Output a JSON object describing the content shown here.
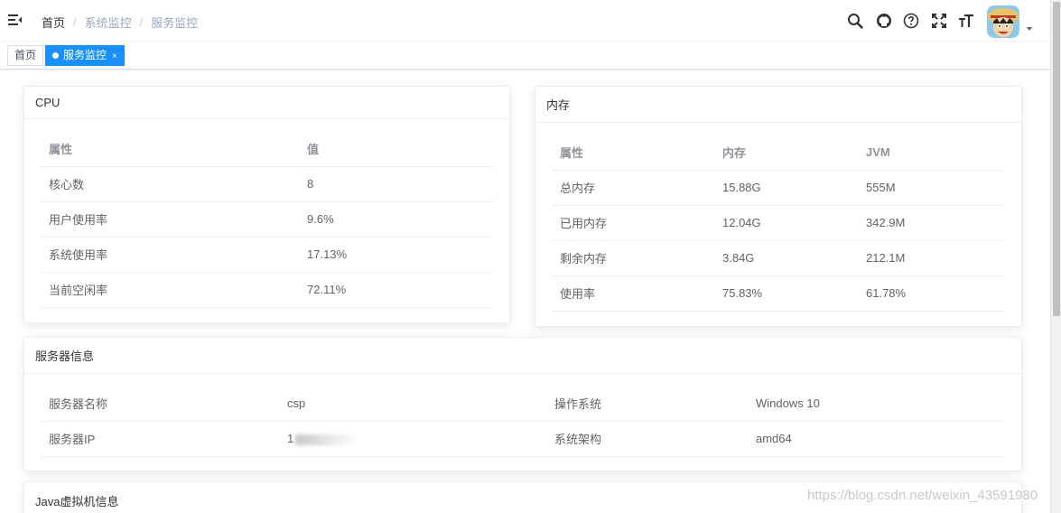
{
  "breadcrumb": {
    "home": "首页",
    "level1": "系统监控",
    "level2": "服务监控"
  },
  "tags": [
    {
      "label": "首页",
      "active": false
    },
    {
      "label": "服务监控",
      "active": true,
      "close": "×"
    }
  ],
  "cpu": {
    "title": "CPU",
    "headers": [
      "属性",
      "值"
    ],
    "rows": [
      [
        "核心数",
        "8"
      ],
      [
        "用户使用率",
        "9.6%"
      ],
      [
        "系统使用率",
        "17.13%"
      ],
      [
        "当前空闲率",
        "72.11%"
      ]
    ]
  },
  "memory": {
    "title": "内存",
    "headers": [
      "属性",
      "内存",
      "JVM"
    ],
    "rows": [
      [
        "总内存",
        "15.88G",
        "555M"
      ],
      [
        "已用内存",
        "12.04G",
        "342.9M"
      ],
      [
        "剩余内存",
        "3.84G",
        "212.1M"
      ],
      [
        "使用率",
        "75.83%",
        "61.78%"
      ]
    ]
  },
  "server": {
    "title": "服务器信息",
    "rows": [
      [
        "服务器名称",
        "csp",
        "操作系统",
        "Windows 10"
      ],
      [
        "服务器IP",
        "1",
        "系统架构",
        "amd64"
      ]
    ]
  },
  "jvm": {
    "title": "Java虚拟机信息"
  },
  "watermark": "https://blog.csdn.net/weixin_43591980",
  "icons": [
    "hamburger-icon",
    "search-icon",
    "github-icon",
    "question-icon",
    "fullscreen-icon",
    "text-size-icon"
  ],
  "colors": {
    "accent": "#1890ff",
    "crumb_muted": "#97a8be"
  }
}
